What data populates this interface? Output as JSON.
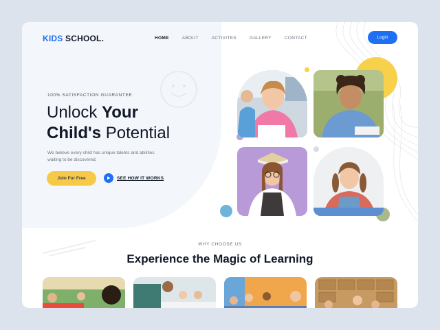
{
  "brand": {
    "logo_kids": "KIDS",
    "logo_school": "SCHOOL.",
    "accent": "#1f6ff5",
    "yellow": "#f7c948"
  },
  "nav": {
    "items": [
      {
        "label": "HOME",
        "active": true
      },
      {
        "label": "ABOUT"
      },
      {
        "label": "ACTIVITES"
      },
      {
        "label": "GALLERY"
      },
      {
        "label": "CONTACT"
      }
    ],
    "login": "Login"
  },
  "hero": {
    "guarantee": "100% SATISFACTION GUARANTEE",
    "headline": {
      "line1_a": "Unlock ",
      "line1_b": "Your",
      "line2_a": "Child's",
      "line2_b": " Potential"
    },
    "subtext": "We believe every child has unique talents and abilities waiting to be discovered.",
    "cta_primary": "Join For Free",
    "cta_secondary": "SEE HOW IT WORKS",
    "icons": [
      "smiley-icon",
      "play-icon"
    ]
  },
  "why": {
    "eyebrow": "WHY CHOOSE US",
    "title": {
      "a": "Experience ",
      "b": "the Magic of",
      "c": " Learning"
    }
  }
}
